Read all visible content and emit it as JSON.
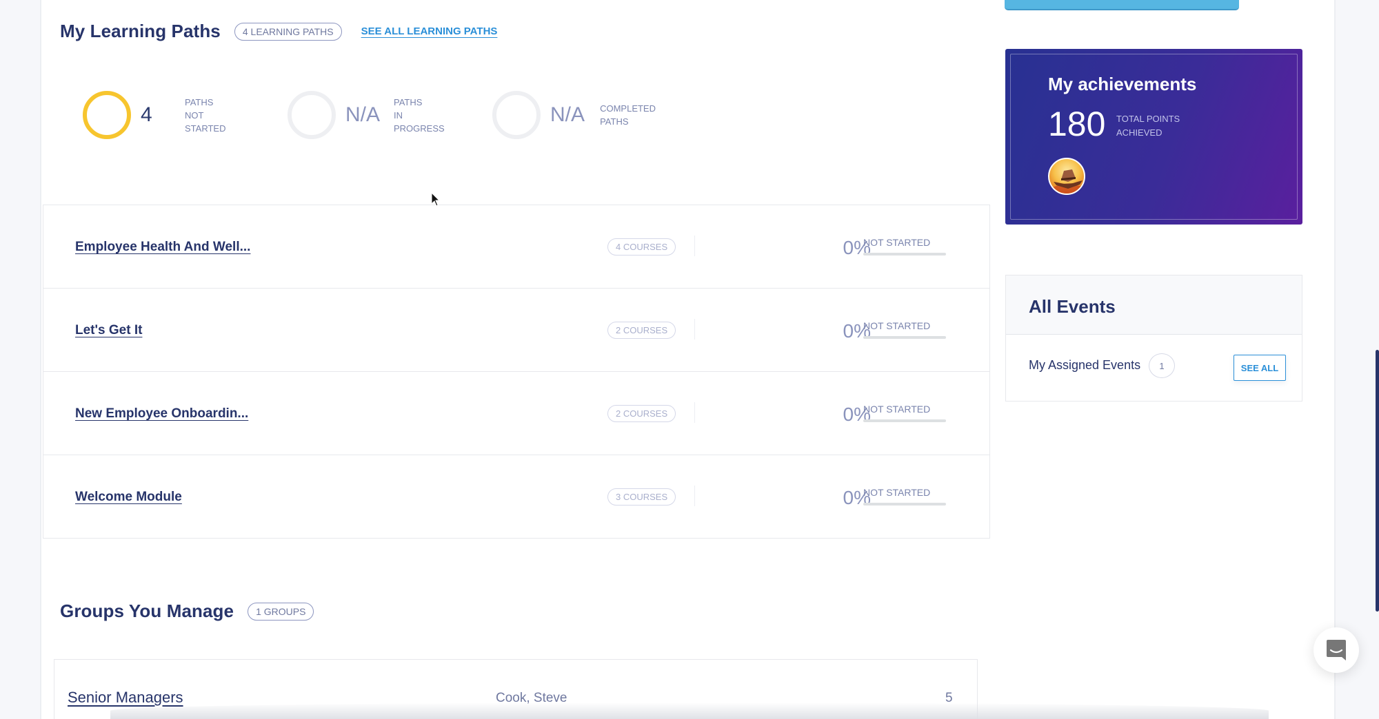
{
  "learning_paths": {
    "title": "My Learning Paths",
    "count_pill": "4 Learning Paths",
    "see_all_label": "See All Learning Paths",
    "stats": [
      {
        "value": "4",
        "label_line1": "Paths",
        "label_line2": "Not Started",
        "active": true
      },
      {
        "value": "N/A",
        "label_line1": "Paths",
        "label_line2": "In Progress",
        "active": false
      },
      {
        "value": "N/A",
        "label_line1": "Completed",
        "label_line2": "Paths",
        "active": false
      }
    ],
    "rows": [
      {
        "name": "Employee Health And Well...",
        "courses": "4 Courses",
        "percent": "0%",
        "status": "Not Started",
        "progress": 0
      },
      {
        "name": "Let's Get It",
        "courses": "2 Courses",
        "percent": "0%",
        "status": "Not Started",
        "progress": 0
      },
      {
        "name": "New Employee Onboardin...",
        "courses": "2 Courses",
        "percent": "0%",
        "status": "Not Started",
        "progress": 0
      },
      {
        "name": "Welcome Module",
        "courses": "3 Courses",
        "percent": "0%",
        "status": "Not Started",
        "progress": 0
      }
    ]
  },
  "groups": {
    "title": "Groups You Manage",
    "count_pill": "1 Groups",
    "rows": [
      {
        "name": "Senior Managers",
        "owner": "Cook, Steve",
        "members": "5"
      }
    ]
  },
  "achievements": {
    "title": "My achievements",
    "points": "180",
    "points_label_line1": "Total Points",
    "points_label_line2": "Achieved",
    "badge_icon": "hat-badge-icon"
  },
  "events": {
    "title": "All Events",
    "assigned_label": "My Assigned Events",
    "assigned_count": "1",
    "see_all_label": "SEE ALL"
  },
  "colors": {
    "accent_blue": "#2a8fd8",
    "navy": "#27346a",
    "ring_active": "#f7c52e",
    "achievement_gradient_start": "#283192",
    "achievement_gradient_end": "#5a1f9e"
  }
}
